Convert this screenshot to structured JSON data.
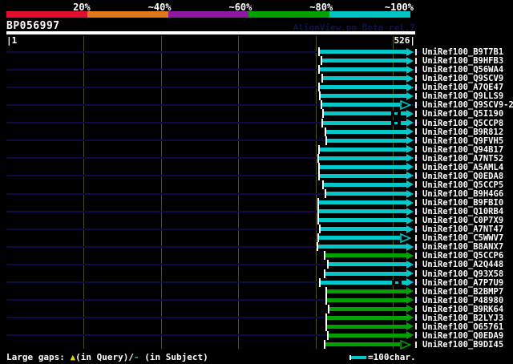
{
  "header": {
    "title": "BP056997",
    "watermark": "AlignView.pm Beta rel.7",
    "ruler_left": "|1",
    "ruler_right": "526|"
  },
  "footer": {
    "large_gaps_prefix": "Large gaps: ",
    "query_gap_symbol": "▲",
    "query_gap_label": "(in Query)/",
    "subject_gap_symbol": "-",
    "subject_gap_label": " (in Subject)",
    "scale_label": "=100char."
  },
  "chart_data": {
    "type": "bar",
    "orientation": "horizontal",
    "query_id": "BP056997",
    "query_range": [
      1,
      526
    ],
    "grid_interval_chars": 100,
    "legend_scale_chars": 100,
    "identity_scale": [
      {
        "label": "20%",
        "color": "#e0102d"
      },
      {
        "label": "~40%",
        "color": "#e07818"
      },
      {
        "label": "~60%",
        "color": "#8c1aa0"
      },
      {
        "label": "~80%",
        "color": "#00a000"
      },
      {
        "label": "~100%",
        "color": "#00c3c3"
      }
    ],
    "bar_colors": {
      "cyan": "#00c8c8",
      "green": "#00a000"
    },
    "rows": [
      {
        "label": "UniRef100_B9T7B1",
        "start": 407,
        "end": 526,
        "color": "cyan",
        "arrow": "filled",
        "subject_gaps": []
      },
      {
        "label": "UniRef100_B9HFB3",
        "start": 410,
        "end": 526,
        "color": "cyan",
        "arrow": "filled",
        "subject_gaps": []
      },
      {
        "label": "UniRef100_Q56WA4",
        "start": 407,
        "end": 526,
        "color": "cyan",
        "arrow": "filled",
        "subject_gaps": []
      },
      {
        "label": "UniRef100_Q9SCV9",
        "start": 411,
        "end": 526,
        "color": "cyan",
        "arrow": "filled",
        "subject_gaps": []
      },
      {
        "label": "UniRef100_A7QE47",
        "start": 407,
        "end": 526,
        "color": "cyan",
        "arrow": "filled",
        "subject_gaps": []
      },
      {
        "label": "UniRef100_Q9LLS9",
        "start": 408,
        "end": 526,
        "color": "cyan",
        "arrow": "filled",
        "subject_gaps": []
      },
      {
        "label": "UniRef100_Q9SCV9-2",
        "start": 410,
        "end": 523,
        "color": "cyan",
        "arrow": "hollow",
        "subject_gaps": []
      },
      {
        "label": "UniRef100_Q5I190",
        "start": 412,
        "end": 526,
        "color": "cyan",
        "arrow": "filled",
        "subject_gaps": [
          503
        ]
      },
      {
        "label": "UniRef100_Q5CCP8",
        "start": 411,
        "end": 526,
        "color": "cyan",
        "arrow": "filled",
        "subject_gaps": [
          503
        ]
      },
      {
        "label": "UniRef100_B9R812",
        "start": 415,
        "end": 526,
        "color": "cyan",
        "arrow": "filled",
        "subject_gaps": []
      },
      {
        "label": "UniRef100_Q9FVH5",
        "start": 416,
        "end": 526,
        "color": "cyan",
        "arrow": "filled",
        "subject_gaps": []
      },
      {
        "label": "UniRef100_Q94B17",
        "start": 407,
        "end": 526,
        "color": "cyan",
        "arrow": "filled",
        "subject_gaps": []
      },
      {
        "label": "UniRef100_A7NT52",
        "start": 406,
        "end": 526,
        "color": "cyan",
        "arrow": "filled",
        "subject_gaps": []
      },
      {
        "label": "UniRef100_A5AML4",
        "start": 407,
        "end": 526,
        "color": "cyan",
        "arrow": "filled",
        "subject_gaps": []
      },
      {
        "label": "UniRef100_Q0EDA8",
        "start": 407,
        "end": 526,
        "color": "cyan",
        "arrow": "filled",
        "subject_gaps": []
      },
      {
        "label": "UniRef100_Q5CCP5",
        "start": 412,
        "end": 526,
        "color": "cyan",
        "arrow": "filled",
        "subject_gaps": []
      },
      {
        "label": "UniRef100_B9H4G6",
        "start": 415,
        "end": 526,
        "color": "cyan",
        "arrow": "filled",
        "subject_gaps": []
      },
      {
        "label": "UniRef100_B9FBI0",
        "start": 406,
        "end": 526,
        "color": "cyan",
        "arrow": "filled",
        "subject_gaps": []
      },
      {
        "label": "UniRef100_Q10RB4",
        "start": 406,
        "end": 526,
        "color": "cyan",
        "arrow": "filled",
        "subject_gaps": []
      },
      {
        "label": "UniRef100_C0P7X9",
        "start": 406,
        "end": 526,
        "color": "cyan",
        "arrow": "filled",
        "subject_gaps": []
      },
      {
        "label": "UniRef100_A7NT47",
        "start": 408,
        "end": 526,
        "color": "cyan",
        "arrow": "filled",
        "subject_gaps": []
      },
      {
        "label": "UniRef100_C5WWV7",
        "start": 406,
        "end": 523,
        "color": "cyan",
        "arrow": "hollow",
        "subject_gaps": []
      },
      {
        "label": "UniRef100_B8ANX7",
        "start": 405,
        "end": 526,
        "color": "cyan",
        "arrow": "filled",
        "subject_gaps": []
      },
      {
        "label": "UniRef100_Q5CCP6",
        "start": 414,
        "end": 526,
        "color": "green",
        "arrow": "filled",
        "subject_gaps": []
      },
      {
        "label": "UniRef100_A2Q448",
        "start": 418,
        "end": 526,
        "color": "cyan",
        "arrow": "filled",
        "subject_gaps": []
      },
      {
        "label": "UniRef100_Q93X58",
        "start": 414,
        "end": 526,
        "color": "cyan",
        "arrow": "filled",
        "subject_gaps": []
      },
      {
        "label": "UniRef100_A7P7U9",
        "start": 408,
        "end": 526,
        "color": "cyan",
        "arrow": "filled",
        "subject_gaps": [
          504
        ]
      },
      {
        "label": "UniRef100_B2BMP7",
        "start": 416,
        "end": 526,
        "color": "green",
        "arrow": "filled",
        "subject_gaps": []
      },
      {
        "label": "UniRef100_P48980",
        "start": 416,
        "end": 526,
        "color": "green",
        "arrow": "filled",
        "subject_gaps": []
      },
      {
        "label": "UniRef100_B9RK64",
        "start": 419,
        "end": 526,
        "color": "green",
        "arrow": "filled",
        "subject_gaps": []
      },
      {
        "label": "UniRef100_B2LYJ3",
        "start": 416,
        "end": 526,
        "color": "green",
        "arrow": "filled",
        "subject_gaps": []
      },
      {
        "label": "UniRef100_O65761",
        "start": 416,
        "end": 526,
        "color": "green",
        "arrow": "filled",
        "subject_gaps": []
      },
      {
        "label": "UniRef100_Q0EDA9",
        "start": 418,
        "end": 526,
        "color": "green",
        "arrow": "filled",
        "subject_gaps": []
      },
      {
        "label": "UniRef100_B9DI45",
        "start": 414,
        "end": 523,
        "color": "green",
        "arrow": "hollow",
        "subject_gaps": []
      }
    ]
  }
}
